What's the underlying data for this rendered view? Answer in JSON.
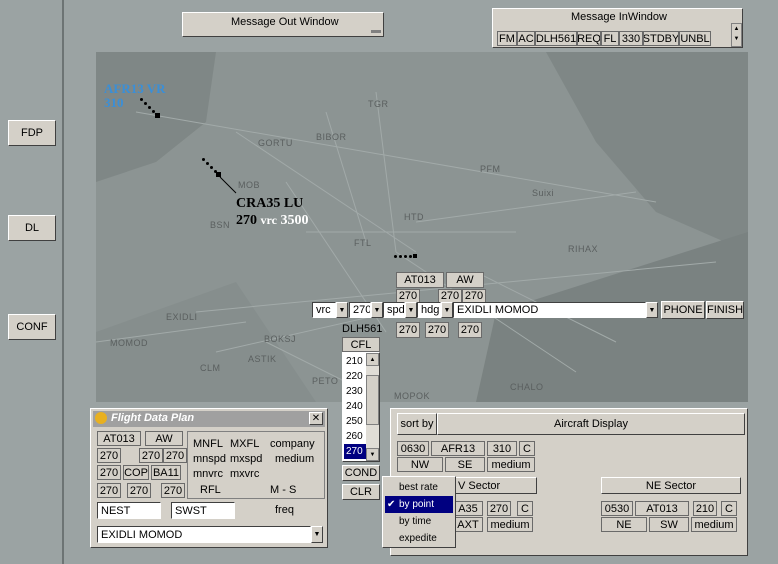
{
  "colors": {
    "background": "#9ba3a3",
    "radar": "#8c9493",
    "panel": "#d4d0c8",
    "selected": "#000080",
    "callsign_blue": "#3a8fd8"
  },
  "left_buttons": [
    "FDP",
    "DL",
    "CONF"
  ],
  "message_out": {
    "title": "Message Out Window"
  },
  "message_in": {
    "title": "Message InWindow",
    "tokens": [
      "FM",
      "AC",
      "DLH561",
      "REQ",
      "FL",
      "330",
      "STDBY",
      "UNBL"
    ]
  },
  "map_labels": [
    "TGR",
    "GORTU",
    "BIBOR",
    "PFM",
    "Suixi",
    "MOB",
    "BSN",
    "HTD",
    "FTL",
    "RIHAX",
    "EXIDLI",
    "MOMOD",
    "BOKSJ",
    "ASTIK",
    "CLM",
    "PETO",
    "CHALO",
    "MOPOK"
  ],
  "track_afr": {
    "callsign": "AFR13 VR",
    "level": "310"
  },
  "track_cra": {
    "callsign": "CRA35 LU",
    "level": "270",
    "mode": "vrc",
    "alt": "3500"
  },
  "flight_label": {
    "callsign": "AT013",
    "type": "AW",
    "row2": [
      "270",
      "270",
      "270"
    ],
    "row3": [
      "270",
      "270",
      "270"
    ]
  },
  "command_bar": {
    "vrc": "vrc",
    "cfl": "270",
    "spd": "spd",
    "hdg": "hdg",
    "route": "EXIDLI MOMOD",
    "phone": "PHONE",
    "finish": "FINISH"
  },
  "cfl_list": {
    "callsign": "DLH561",
    "header": "CFL",
    "items": [
      "210",
      "220",
      "230",
      "240",
      "250",
      "260",
      "270"
    ],
    "selected": "270",
    "cond": "COND",
    "clr": "CLR"
  },
  "fdp_window": {
    "title": "Flight Data Plan",
    "callsign": "AT013",
    "type": "AW",
    "row2": [
      "270",
      "270",
      "270"
    ],
    "row3": [
      "270",
      "COP",
      "BA11"
    ],
    "row4": [
      "270",
      "270",
      "270"
    ],
    "labels": [
      "MNFL",
      "MXFL",
      "company",
      "mnspd",
      "mxspd",
      "medium",
      "mnvrc",
      "mxvrc",
      "RFL",
      "M - S"
    ],
    "field1": "NEST",
    "field2": "SWST",
    "freq": "freq",
    "route": "EXIDLI MOMOD"
  },
  "aircraft_display": {
    "sort": "sort by",
    "title": "Aircraft Display",
    "west": {
      "row1": [
        "0630",
        "AFR13",
        "310",
        "C"
      ],
      "row2": [
        "NW",
        "SE",
        "medium"
      ]
    },
    "mid_sector": "V Sector",
    "mid": {
      "row1": [
        "A35",
        "270",
        "C"
      ],
      "row2": [
        "AXT",
        "medium"
      ]
    },
    "ne_sector": "NE Sector",
    "ne": {
      "row1": [
        "0530",
        "AT013",
        "210",
        "C"
      ],
      "row2": [
        "NE",
        "SW",
        "medium"
      ]
    }
  },
  "sort_menu": {
    "items": [
      "best rate",
      "by point",
      "by time",
      "expedite"
    ],
    "selected": "by point"
  }
}
